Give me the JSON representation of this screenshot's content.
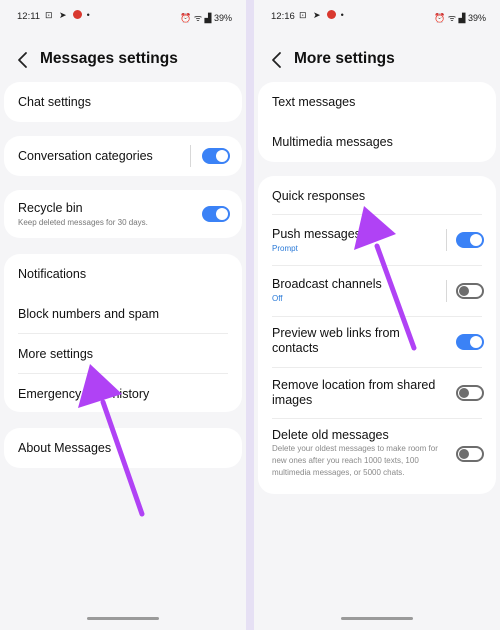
{
  "left": {
    "status": {
      "time": "12:11",
      "battery": "39%"
    },
    "header": {
      "title": "Messages settings"
    },
    "rows": {
      "chat_settings": "Chat settings",
      "conversation_categories": "Conversation categories",
      "recycle_bin": "Recycle bin",
      "recycle_bin_sub": "Keep deleted messages for 30 days.",
      "notifications": "Notifications",
      "block_numbers": "Block numbers and spam",
      "more_settings": "More settings",
      "emergency": "Emergency alert history",
      "about": "About Messages"
    },
    "toggles": {
      "conversation_categories": true,
      "recycle_bin": true
    }
  },
  "right": {
    "status": {
      "time": "12:16",
      "battery": "39%"
    },
    "header": {
      "title": "More settings"
    },
    "rows": {
      "text_messages": "Text messages",
      "multimedia_messages": "Multimedia messages",
      "quick_responses": "Quick responses",
      "push_messages": "Push messages",
      "push_messages_sub": "Prompt",
      "broadcast_channels": "Broadcast channels",
      "broadcast_channels_sub": "Off",
      "preview_links_1": "Preview web links from",
      "preview_links_2": "contacts",
      "remove_location_1": "Remove location from shared",
      "remove_location_2": "images",
      "delete_old": "Delete old messages",
      "delete_old_desc": "Delete your oldest messages to make room for new ones after you reach 1000 texts, 100 multimedia messages, or 5000 chats."
    },
    "toggles": {
      "push_messages": true,
      "broadcast_channels": false,
      "preview_links": true,
      "remove_location": false,
      "delete_old": false
    }
  },
  "colors": {
    "toggle_on": "#3b82f6",
    "arrow": "#b042f5",
    "accent_blue": "#2a7ad8"
  },
  "icons": [
    "back-arrow-icon",
    "signal-icon",
    "wifi-icon",
    "battery-icon",
    "pointer-arrow-icon"
  ]
}
